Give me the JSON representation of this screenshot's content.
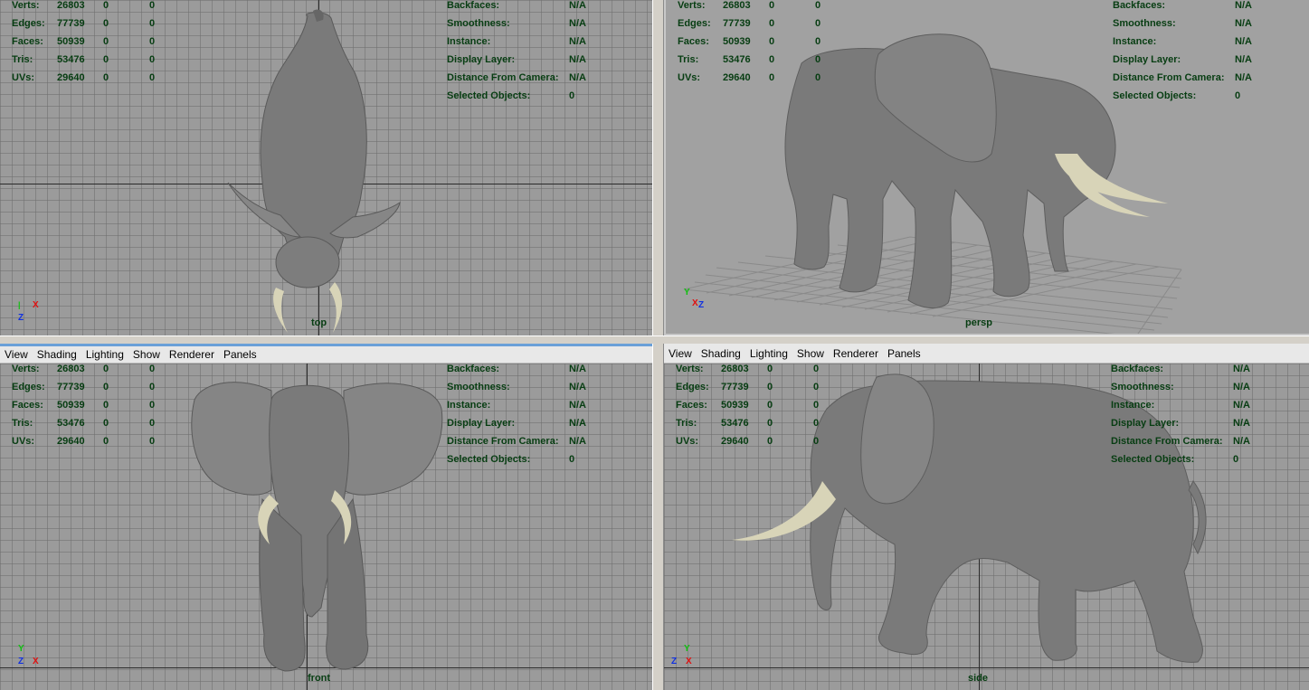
{
  "stats": [
    {
      "key": "Verts:",
      "v1": "26803",
      "v2": "0",
      "v3": "0"
    },
    {
      "key": "Edges:",
      "v1": "77739",
      "v2": "0",
      "v3": "0"
    },
    {
      "key": "Faces:",
      "v1": "50939",
      "v2": "0",
      "v3": "0"
    },
    {
      "key": "Tris:",
      "v1": "53476",
      "v2": "0",
      "v3": "0"
    },
    {
      "key": "UVs:",
      "v1": "29640",
      "v2": "0",
      "v3": "0"
    }
  ],
  "info": [
    {
      "key": "Backfaces:",
      "val": "N/A"
    },
    {
      "key": "Smoothness:",
      "val": "N/A"
    },
    {
      "key": "Instance:",
      "val": "N/A"
    },
    {
      "key": "Display Layer:",
      "val": "N/A"
    },
    {
      "key": "Distance From Camera:",
      "val": "N/A"
    },
    {
      "key": "Selected Objects:",
      "val": "0"
    }
  ],
  "menu": [
    "View",
    "Shading",
    "Lighting",
    "Show",
    "Renderer",
    "Panels"
  ],
  "cameras": {
    "top": "top",
    "persp": "persp",
    "front": "front",
    "side": "side"
  },
  "gizmo_axes": {
    "x": "X",
    "y": "Y",
    "z": "Z"
  },
  "colors": {
    "hud_text": "#073d12",
    "viewport_bg": "#9b9b9b",
    "grid_line": "#6e6e6e",
    "model": "#7a7a7a",
    "tusk": "#d8d4b8",
    "axis_x": "#e01010",
    "axis_y": "#10c010",
    "axis_z": "#1030e0",
    "active_panel_border": "#6aa0d8"
  }
}
